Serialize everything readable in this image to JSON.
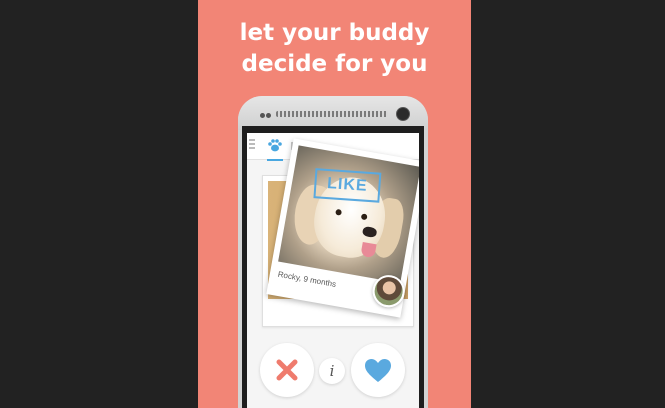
{
  "promo": {
    "headline_line1": "let your buddy",
    "headline_line2": "decide for you"
  },
  "app": {
    "tabs": [
      {
        "icon": "paw-icon",
        "active": true
      },
      {
        "icon": "unknown-icon",
        "active": false
      }
    ],
    "card": {
      "stamp": "LIKE",
      "caption": "Rocky, 9 months"
    },
    "actions": {
      "dislike_icon": "x-icon",
      "info_label": "i",
      "like_icon": "heart-icon"
    }
  },
  "colors": {
    "background": "#222222",
    "promo_background": "#f28576",
    "accent_blue": "#5aa9df",
    "dislike_red": "#ef7b6d",
    "like_blue": "#5aa9df"
  }
}
